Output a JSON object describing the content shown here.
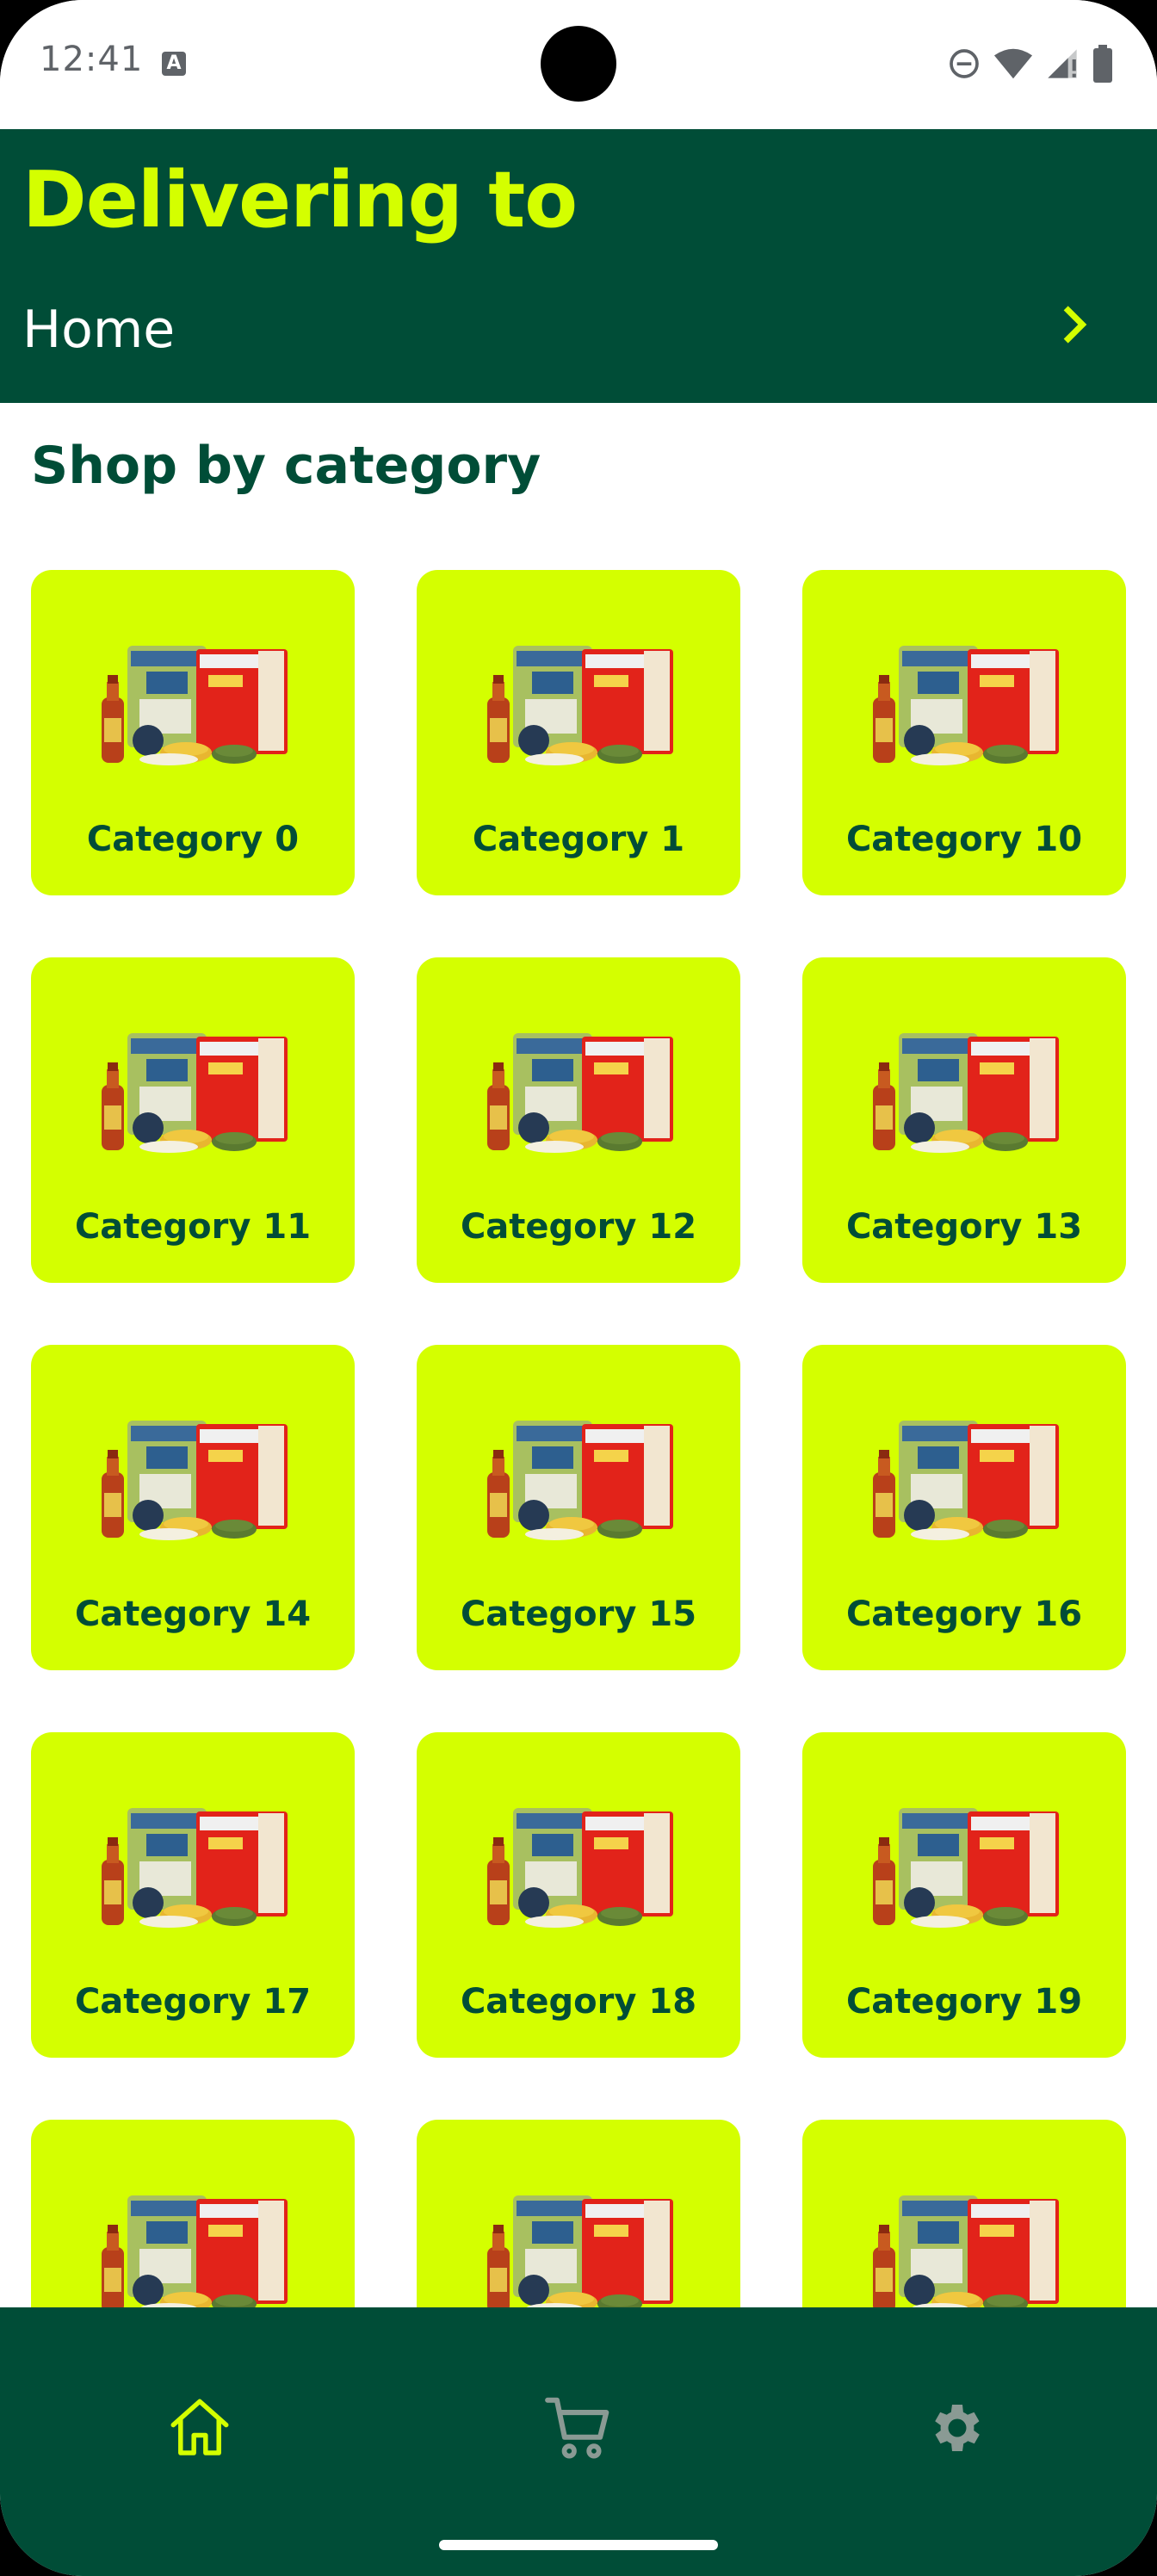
{
  "status_bar": {
    "time": "12:41",
    "left_icons": [
      "a-notification-icon"
    ],
    "right_icons": [
      "do-not-disturb-icon",
      "wifi-icon",
      "signal-icon",
      "battery-icon"
    ]
  },
  "header": {
    "title": "Delivering to",
    "address": "Home",
    "chevron_icon": "chevron-right-icon"
  },
  "section": {
    "title": "Shop by category"
  },
  "categories": [
    {
      "label": "Category 0"
    },
    {
      "label": "Category 1"
    },
    {
      "label": "Category 10"
    },
    {
      "label": "Category 11"
    },
    {
      "label": "Category 12"
    },
    {
      "label": "Category 13"
    },
    {
      "label": "Category 14"
    },
    {
      "label": "Category 15"
    },
    {
      "label": "Category 16"
    },
    {
      "label": "Category 17"
    },
    {
      "label": "Category 18"
    },
    {
      "label": "Category 19"
    },
    {
      "label": ""
    },
    {
      "label": ""
    },
    {
      "label": ""
    }
  ],
  "bottom_nav": {
    "items": [
      {
        "icon": "home-icon",
        "active": true
      },
      {
        "icon": "cart-icon",
        "active": false
      },
      {
        "icon": "gear-icon",
        "active": false
      }
    ]
  },
  "colors": {
    "primary_dark_green": "#004d37",
    "accent_lime": "#d4ff00",
    "text_white": "#ffffff",
    "inactive_icon": "#8a9a94"
  }
}
